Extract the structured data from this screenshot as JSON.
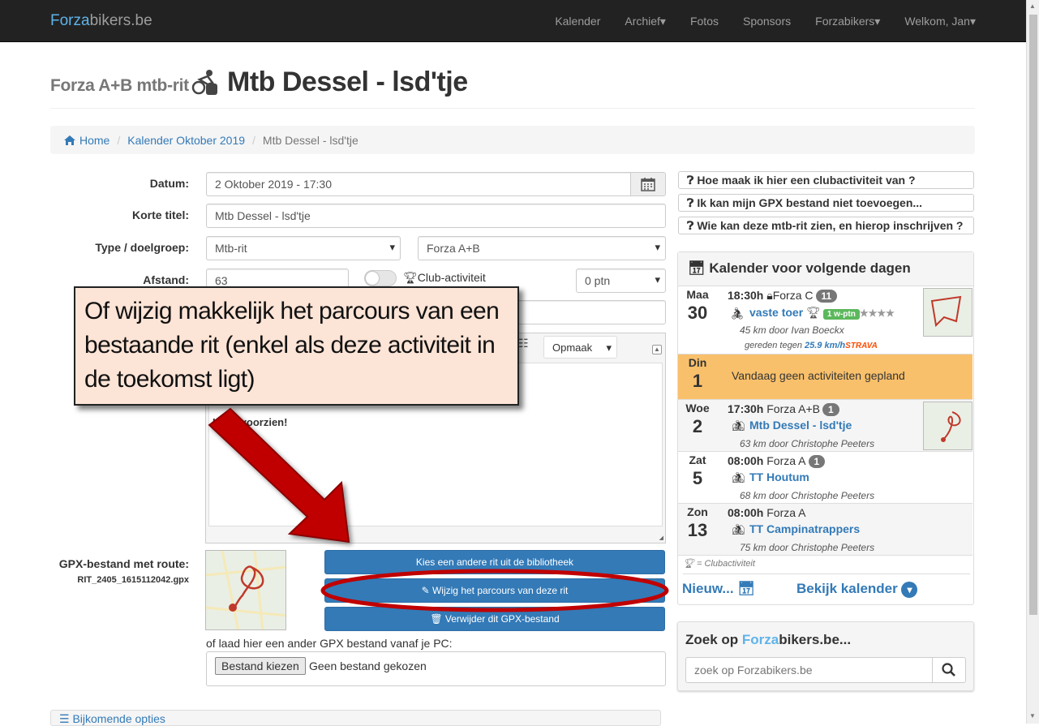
{
  "nav": {
    "brand_part1": "Forza",
    "brand_part2": "bikers.be",
    "items": [
      "Kalender",
      "Archief▾",
      "Fotos",
      "Sponsors",
      "Forzabikers▾",
      "Welkom, Jan▾"
    ]
  },
  "header": {
    "small": "Forza A+B mtb-rit",
    "title": "Mtb Dessel - lsd'tje"
  },
  "breadcrumb": {
    "home": "Home",
    "month": "Kalender Oktober 2019",
    "current": "Mtb Dessel - lsd'tje"
  },
  "form": {
    "datum_label": "Datum:",
    "datum_value": "2 Oktober 2019 - 17:30",
    "titel_label": "Korte titel:",
    "titel_value": "Mtb Dessel - lsd'tje",
    "type_label": "Type / doelgroep:",
    "type_value": "Mtb-rit",
    "groep_value": "Forza A+B",
    "afstand_label": "Afstand:",
    "afstand_value": "63",
    "club_label": "Club-activiteit",
    "ptn_value": "0 ptn",
    "opmaak": "Opmaak",
    "editor_fragment": "Li",
    "editor_text": "Licht voorzien!",
    "gpx_label": "GPX-bestand met route:",
    "gpx_file": "RIT_2405_1615112042.gpx",
    "btn_kies": "Kies een andere rit uit de bibliotheek",
    "btn_wijzig": "Wijzig het parcours van deze rit",
    "btn_verwijder": "Verwijder dit GPX-bestand",
    "upload_text": "of laad hier een ander GPX bestand vanaf je PC:",
    "file_button": "Bestand kiezen",
    "file_none": "Geen bestand gekozen",
    "extra_options": "Bijkomende opties"
  },
  "help": [
    "Hoe maak ik hier een clubactiviteit van ?",
    "Ik kan mijn GPX bestand niet toevoegen...",
    "Wie kan deze mtb-rit zien, en hierop inschrijven ?"
  ],
  "calendar": {
    "title": "Kalender voor volgende dagen",
    "rows": [
      {
        "dow": "Maa",
        "day": "30",
        "time": "18:30h",
        "group": "Forza C",
        "count": "11",
        "name": "vaste toer",
        "tag": "1 w-ptn",
        "stars": "★★★★",
        "sub": "45 km door Ivan Boeckx",
        "sub2": "gereden tegen",
        "speed": "25.9 km/h",
        "strava": "STRAVA"
      },
      {
        "dow": "Din",
        "day": "1",
        "note": "Vandaag geen activiteiten gepland"
      },
      {
        "dow": "Woe",
        "day": "2",
        "time": "17:30h",
        "group": "Forza A+B",
        "count": "1",
        "name": "Mtb Dessel - lsd'tje",
        "sub": "63 km door Christophe Peeters"
      },
      {
        "dow": "Zat",
        "day": "5",
        "time": "08:00h",
        "group": "Forza A",
        "count": "1",
        "name": "TT Houtum",
        "sub": "68 km door Christophe Peeters"
      },
      {
        "dow": "Zon",
        "day": "13",
        "time": "08:00h",
        "group": "Forza A",
        "name": "TT Campinatrappers",
        "sub": "75 km door Christophe Peeters"
      }
    ],
    "legend": "= Clubactiviteit",
    "new": "Nieuw...",
    "view": "Bekijk kalender"
  },
  "search": {
    "title_a": "Zoek op ",
    "title_b": "Forza",
    "title_c": "bikers.be...",
    "placeholder": "zoek op Forzabikers.be"
  },
  "overlay": {
    "text": "Of wijzig makkelijk het parcours van een bestaande rit (enkel als deze activiteit in de toekomst ligt)"
  },
  "colors": {
    "accent": "#337ab7",
    "today": "#f9c06b",
    "annotation_red": "#c00000"
  }
}
